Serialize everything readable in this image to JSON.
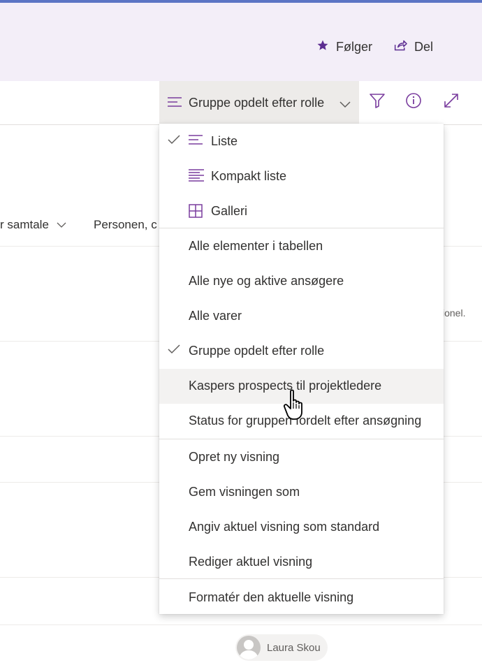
{
  "header": {
    "follow_label": "Følger",
    "share_label": "Del"
  },
  "commandbar": {
    "current_view": "Gruppe opdelt efter rolle",
    "icons": [
      "filter-icon",
      "info-icon",
      "expand-icon"
    ]
  },
  "list": {
    "column_headers": [
      "r samtale",
      "Personen, c"
    ],
    "right_snippet": "sionel.",
    "person_name": "Laura Skou"
  },
  "menu": {
    "layouts": [
      {
        "label": "Liste",
        "icon": "list-icon",
        "checked": true
      },
      {
        "label": "Kompakt liste",
        "icon": "compact-list-icon",
        "checked": false
      },
      {
        "label": "Galleri",
        "icon": "gallery-icon",
        "checked": false
      }
    ],
    "views": [
      {
        "label": "Alle elementer i tabellen",
        "checked": false
      },
      {
        "label": "Alle nye og aktive ansøgere",
        "checked": false
      },
      {
        "label": "Alle varer",
        "checked": false
      },
      {
        "label": "Gruppe opdelt efter rolle",
        "checked": true
      },
      {
        "label": "Kaspers prospects til projektledere",
        "checked": false,
        "hovered": true
      },
      {
        "label": "Status for gruppen fordelt efter ansøgning",
        "checked": false
      }
    ],
    "actions": [
      {
        "label": "Opret ny visning"
      },
      {
        "label": "Gem visningen som"
      },
      {
        "label": "Angiv aktuel visning som standard"
      },
      {
        "label": "Rediger aktuel visning"
      }
    ],
    "format": {
      "label": "Formatér den aktuelle visning"
    }
  },
  "colors": {
    "accent": "#7a3d9e",
    "header_bg": "#f3eef8",
    "top_bar": "#5b74c4"
  }
}
